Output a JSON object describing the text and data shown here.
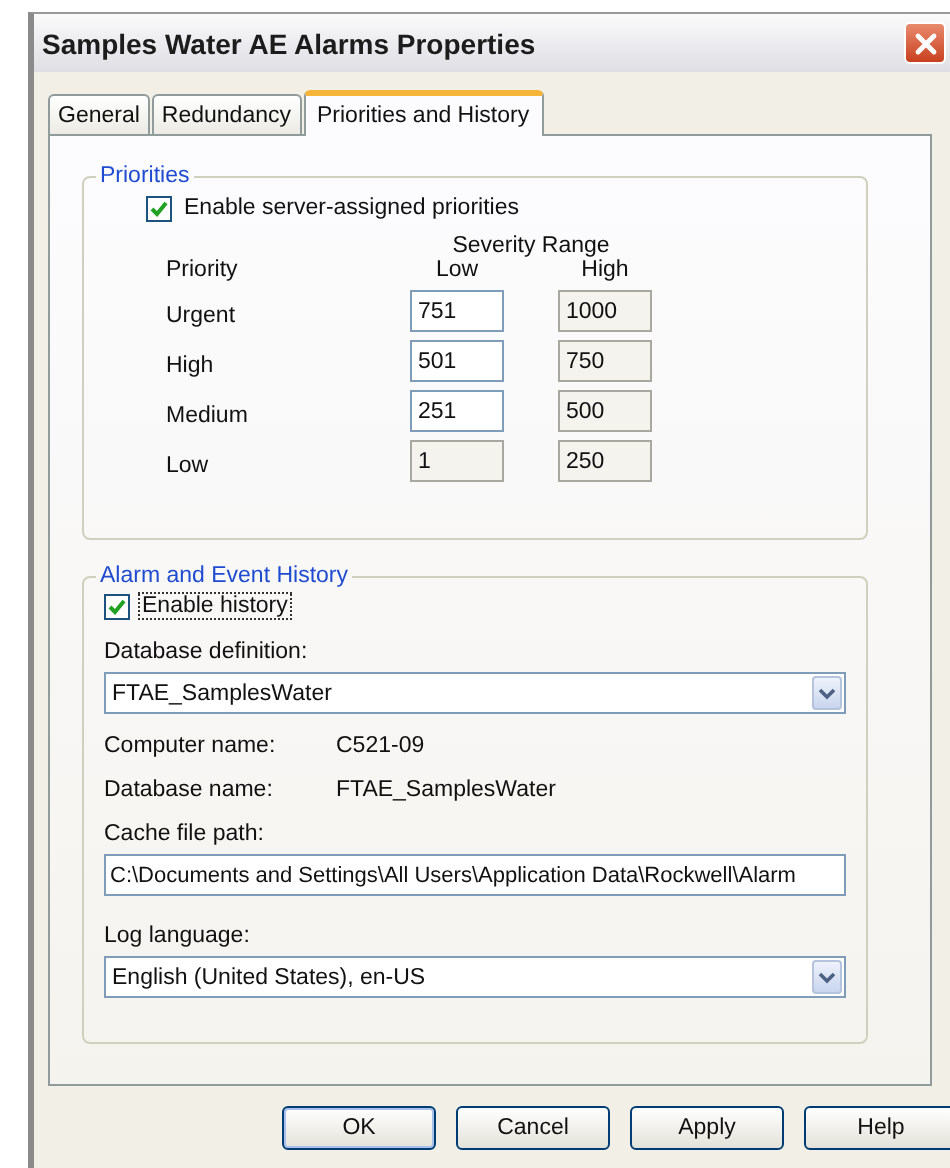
{
  "window": {
    "title": "Samples Water AE Alarms Properties"
  },
  "tabs": [
    {
      "label": "General",
      "selected": false
    },
    {
      "label": "Redundancy",
      "selected": false
    },
    {
      "label": "Priorities and History",
      "selected": true
    }
  ],
  "priorities": {
    "title": "Priorities",
    "enable": {
      "label": "Enable server-assigned priorities",
      "checked": true,
      "focused": false
    },
    "range_header": "Severity Range",
    "columns": [
      "Priority",
      "Low",
      "High"
    ],
    "rows": [
      {
        "name": "Urgent",
        "low": {
          "value": "751",
          "disabled": false
        },
        "high": {
          "value": "1000",
          "disabled": true
        }
      },
      {
        "name": "High",
        "low": {
          "value": "501",
          "disabled": false
        },
        "high": {
          "value": "750",
          "disabled": true
        }
      },
      {
        "name": "Medium",
        "low": {
          "value": "251",
          "disabled": false
        },
        "high": {
          "value": "500",
          "disabled": true
        }
      },
      {
        "name": "Low",
        "low": {
          "value": "1",
          "disabled": true
        },
        "high": {
          "value": "250",
          "disabled": true
        }
      }
    ]
  },
  "history": {
    "title": "Alarm and Event History",
    "enable": {
      "label": "Enable history",
      "checked": true,
      "focused": true
    },
    "database_definition": {
      "label": "Database definition:",
      "value": "FTAE_SamplesWater"
    },
    "computer_name": {
      "label": "Computer name:",
      "value": "C521-09"
    },
    "database_name": {
      "label": "Database name:",
      "value": "FTAE_SamplesWater"
    },
    "cache_file_path": {
      "label": "Cache file path:",
      "value": "C:\\Documents and Settings\\All Users\\Application Data\\Rockwell\\Alarm"
    },
    "log_language": {
      "label": "Log language:",
      "value": "English (United States), en-US"
    }
  },
  "buttons": [
    {
      "label": "OK",
      "default": true
    },
    {
      "label": "Cancel",
      "default": false
    },
    {
      "label": "Apply",
      "default": false
    },
    {
      "label": "Help",
      "default": false
    }
  ]
}
